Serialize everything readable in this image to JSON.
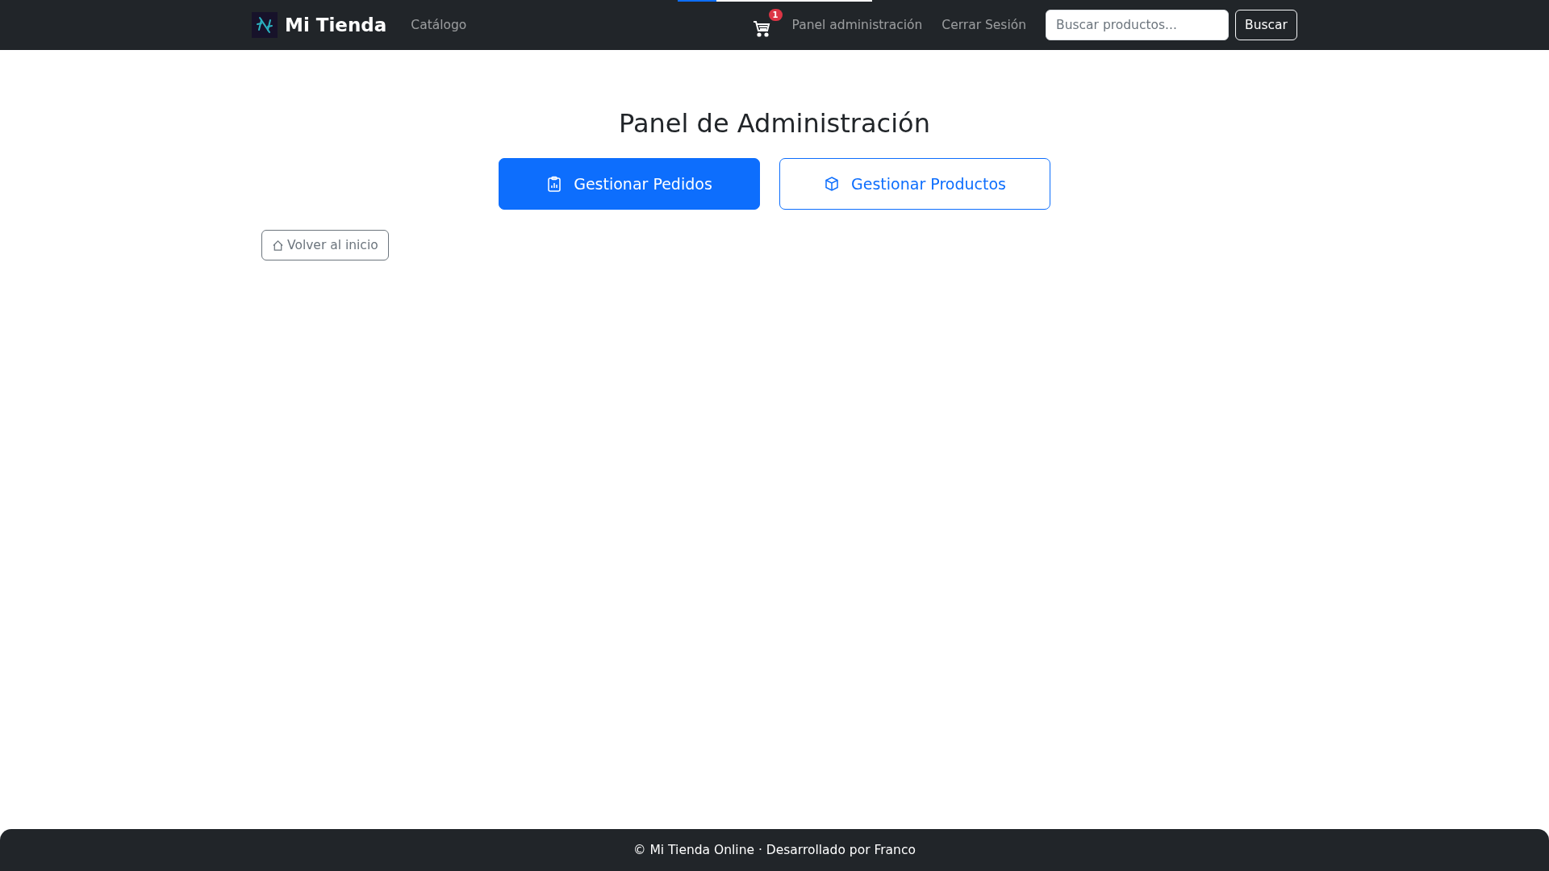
{
  "navbar": {
    "brand": "Mi Tienda",
    "links": [
      {
        "label": "Catálogo"
      }
    ],
    "cart": {
      "count": "1"
    },
    "right_links": [
      {
        "label": "Panel administración"
      },
      {
        "label": "Cerrar Sesión"
      }
    ],
    "search": {
      "placeholder": "Buscar productos..."
    },
    "search_button": "Buscar"
  },
  "title": "Panel de Administración",
  "actions": [
    {
      "label": "Gestionar Pedidos",
      "kind": "primary"
    },
    {
      "label": "Gestionar Productos",
      "kind": "outline"
    }
  ],
  "back_button": "Volver al inicio",
  "footer": "© Mi Tienda Online · Desarrollado por Franco"
}
